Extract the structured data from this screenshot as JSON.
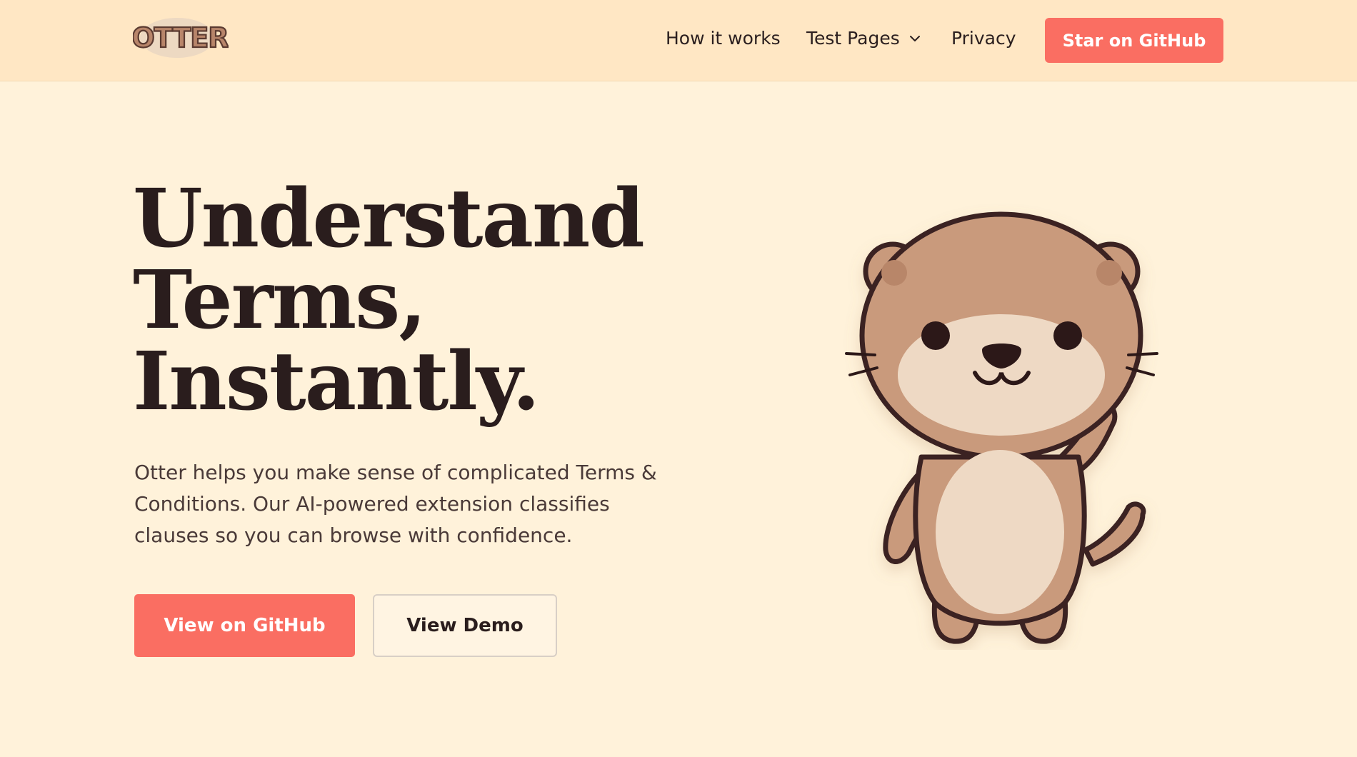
{
  "header": {
    "logo_text": "OTTER",
    "nav": {
      "how_it_works": "How it works",
      "test_pages": "Test Pages",
      "privacy": "Privacy"
    },
    "star_button": "Star on GitHub"
  },
  "hero": {
    "title_lines": [
      "Understand",
      "Terms,",
      "Instantly."
    ],
    "description": "Otter helps you make sense of complicated Terms & Conditions. Our AI-powered extension classifies clauses so you can browse with confidence.",
    "primary_button": "View on GitHub",
    "secondary_button": "View Demo"
  },
  "colors": {
    "header_bg": "#FFE7C4",
    "page_bg": "#FFF2DA",
    "accent": "#FA6E62",
    "otter_fur": "#C99A7C",
    "otter_belly": "#EED9C4",
    "outline": "#3A2424"
  },
  "icons": {
    "dropdown": "chevron-down-icon",
    "mascot": "otter-mascot-illustration"
  }
}
